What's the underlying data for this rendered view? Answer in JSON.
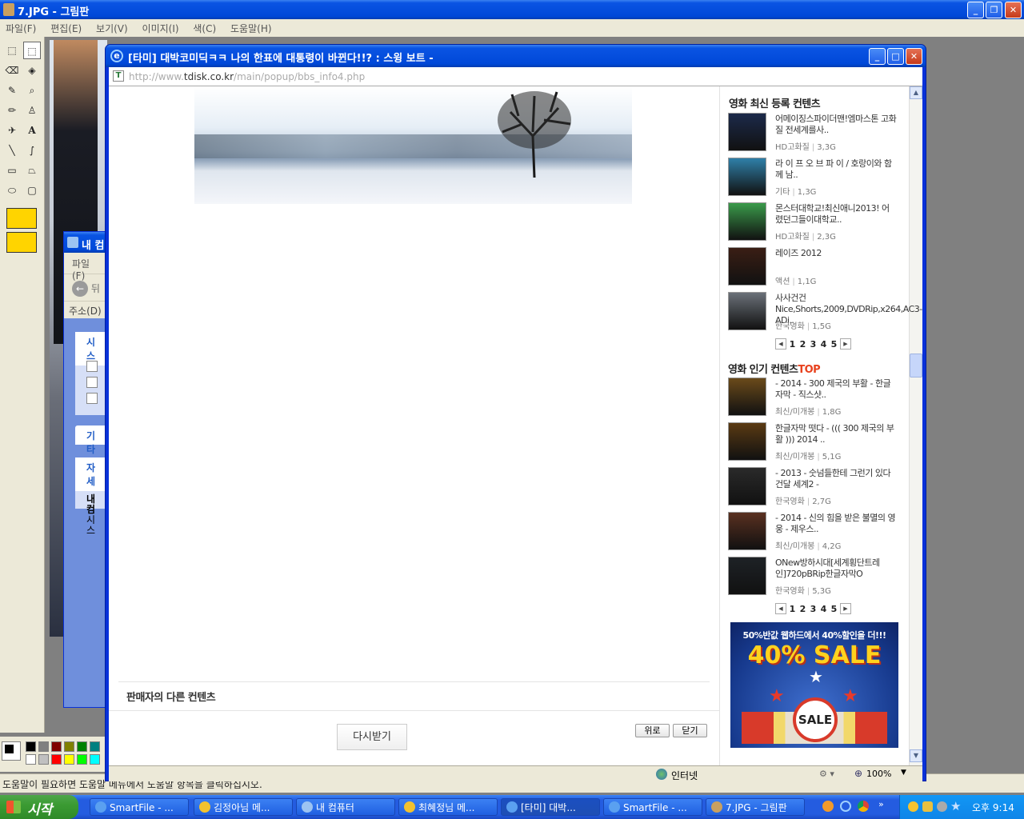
{
  "paint": {
    "title": "7.JPG - 그림판",
    "menu": [
      "파일(F)",
      "편집(E)",
      "보기(V)",
      "이미지(I)",
      "색(C)",
      "도움말(H)"
    ],
    "status": "도움말이 필요하면 도움말 메뉴에서 도움말 항목을 클릭하십시오."
  },
  "mycomputer": {
    "title": "내 컴",
    "menu": "파일(F)",
    "back": "뒤",
    "address": "주소(D)",
    "panel1": "시스",
    "panel2": "기타",
    "panel3": "자세",
    "detail1": "내 컴",
    "detail2": "시스"
  },
  "popup": {
    "title": "[타미] 대박코미딕ㅋㅋ 나의 한표에 대통령이 바뀐다!!? : 스윙 보트 -",
    "url_prefix": "http://www.",
    "url_domain": "tdisk.co.kr",
    "url_path": "/main/popup/bbs_info4.php",
    "seller_heading": "판매자의 다른 컨텐츠",
    "redownload": "다시받기",
    "top_btn": "위로",
    "close_btn": "닫기",
    "status_zone": "인터넷",
    "zoom": "100%"
  },
  "sidebar": {
    "recent_title": "영화 최신 등록 컨텐츠",
    "recent": [
      {
        "title": "어메이징스파이더맨!엠마스톤 고화질 전세계를사..",
        "cat": "HD고화질",
        "size": "3,3G",
        "color": "#1c2a4a"
      },
      {
        "title": "라 이 프 오 브 파 이 / 호랑이와 함께 남..",
        "cat": "기타",
        "size": "1,3G",
        "color": "#2f7fa8"
      },
      {
        "title": "몬스터대학교!최신애니2013! 어렸던그들이대학교..",
        "cat": "HD고화질",
        "size": "2,3G",
        "color": "#3a9a4a"
      },
      {
        "title": "레이즈 2012",
        "cat": "액션",
        "size": "1,1G",
        "color": "#3a1e14"
      },
      {
        "title": "사사건건 Nice,Shorts,2009,DVDRip,x264,AC3-ADi..",
        "cat": "한국영화",
        "size": "1,5G",
        "color": "#6a7078"
      }
    ],
    "pages": [
      "1",
      "2",
      "3",
      "4",
      "5"
    ],
    "popular_title_main": "영화 인기 컨텐츠",
    "popular_title_accent": "TOP",
    "popular": [
      {
        "title": "- 2014 - 300 제국의 부활 - 한글자막 - 직스샷..",
        "cat": "최신/미개봉",
        "size": "1,8G",
        "color": "#6a4a1a"
      },
      {
        "title": "한글자막 떳다 - ((( 300 제국의 부활 ))) 2014 ..",
        "cat": "최신/미개봉",
        "size": "5,1G",
        "color": "#5a3a12"
      },
      {
        "title": "- 2013 - 숫넘들한테 그런기 있다 건달 세계2 -",
        "cat": "한국영화",
        "size": "2,7G",
        "color": "#2a2a2a"
      },
      {
        "title": "- 2014 - 신의 힘을 받은 불멸의 영웅 - 제우스..",
        "cat": "최신/미개봉",
        "size": "4,2G",
        "color": "#5a3020"
      },
      {
        "title": "ONew방하시대[세계횡단트레인]720pBRip한글자막O",
        "cat": "한국영화",
        "size": "5,3G",
        "color": "#1e2226"
      }
    ],
    "ad_line": "50%반값 웹하드에서 40%할인을 더!!!",
    "ad_big": "40% SALE",
    "ad_badge": "SALE"
  },
  "taskbar": {
    "start": "시작",
    "buttons": [
      "SmartFile - ...",
      "김정아님 메...",
      "내 컴퓨터",
      "최혜정님 메...",
      "[타미] 대박...",
      "SmartFile - ...",
      "7.JPG - 그림판"
    ],
    "time": "오후 9:14"
  },
  "colors": {
    "xp_blue": "#0a54e3",
    "accent_red": "#e8421e",
    "ad_yellow": "#ffd21e"
  }
}
